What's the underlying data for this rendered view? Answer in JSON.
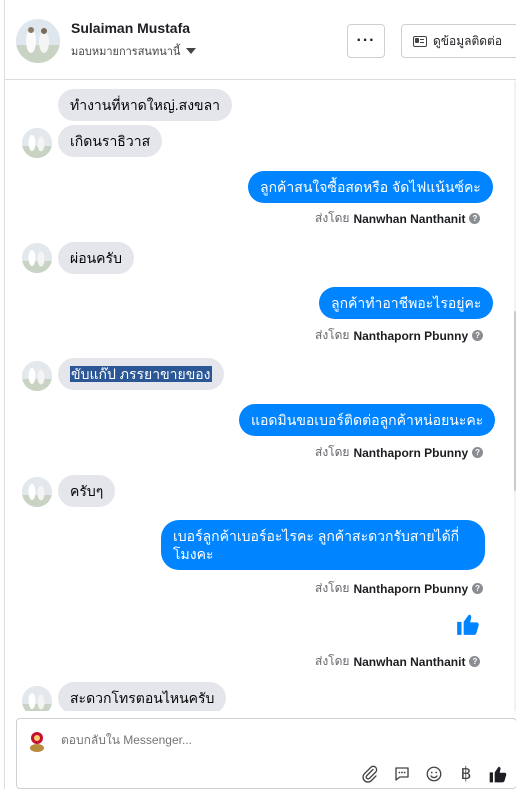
{
  "header": {
    "name": "Sulaiman Mustafa",
    "assign_label": "มอบหมายการสนทนานี้",
    "more_label": "···",
    "contact_label": "ดูข้อมูลติดต่อ"
  },
  "messages": [
    {
      "side": "in",
      "text": "ทำงานที่หาดใหญ่.สงขลา"
    },
    {
      "side": "in",
      "text": "เกิดนราธิวาส"
    },
    {
      "side": "out",
      "text": "ลูกค้าสนใจซื้อสดหรือ จัดไฟแน้นซ์คะ",
      "sent_by_prefix": "ส่งโดย",
      "sent_by": "Nanwhan Nanthanit"
    },
    {
      "side": "in",
      "text": "ผ่อนครับ"
    },
    {
      "side": "out",
      "text": "ลูกค้าทำอาชีพอะไรอยู่คะ",
      "sent_by_prefix": "ส่งโดย",
      "sent_by": "Nanthaporn Pbunny"
    },
    {
      "side": "in",
      "text": "ขับแก๊ป ภรรยาขายของ",
      "selected": true
    },
    {
      "side": "out",
      "text": "แอดมินขอเบอร์ติดต่อลูกค้าหน่อยนะคะ",
      "sent_by_prefix": "ส่งโดย",
      "sent_by": "Nanthaporn Pbunny"
    },
    {
      "side": "in",
      "text": "ครับๆ"
    },
    {
      "side": "out",
      "text": "เบอร์ลูกค้าเบอร์อะไรคะ ลูกค้าสะดวกรับสายได้กี่โมงคะ",
      "sent_by_prefix": "ส่งโดย",
      "sent_by": "Nanthaporn Pbunny"
    },
    {
      "side": "out",
      "type": "like",
      "icon": "thumbs-up-icon",
      "sent_by_prefix": "ส่งโดย",
      "sent_by": "Nanwhan Nanthanit"
    },
    {
      "side": "in",
      "text": "สะดวกโทรตอนไหนครับ"
    }
  ],
  "composer": {
    "placeholder": "ตอบกลับใน Messenger...",
    "tools": [
      "paperclip-icon",
      "chat-bubble-icon",
      "emoji-icon",
      "baht-icon",
      "thumbs-up-icon"
    ]
  },
  "colors": {
    "outgoing_bubble": "#0084ff",
    "incoming_bubble": "#e4e6eb",
    "selection": "#2b5797"
  }
}
